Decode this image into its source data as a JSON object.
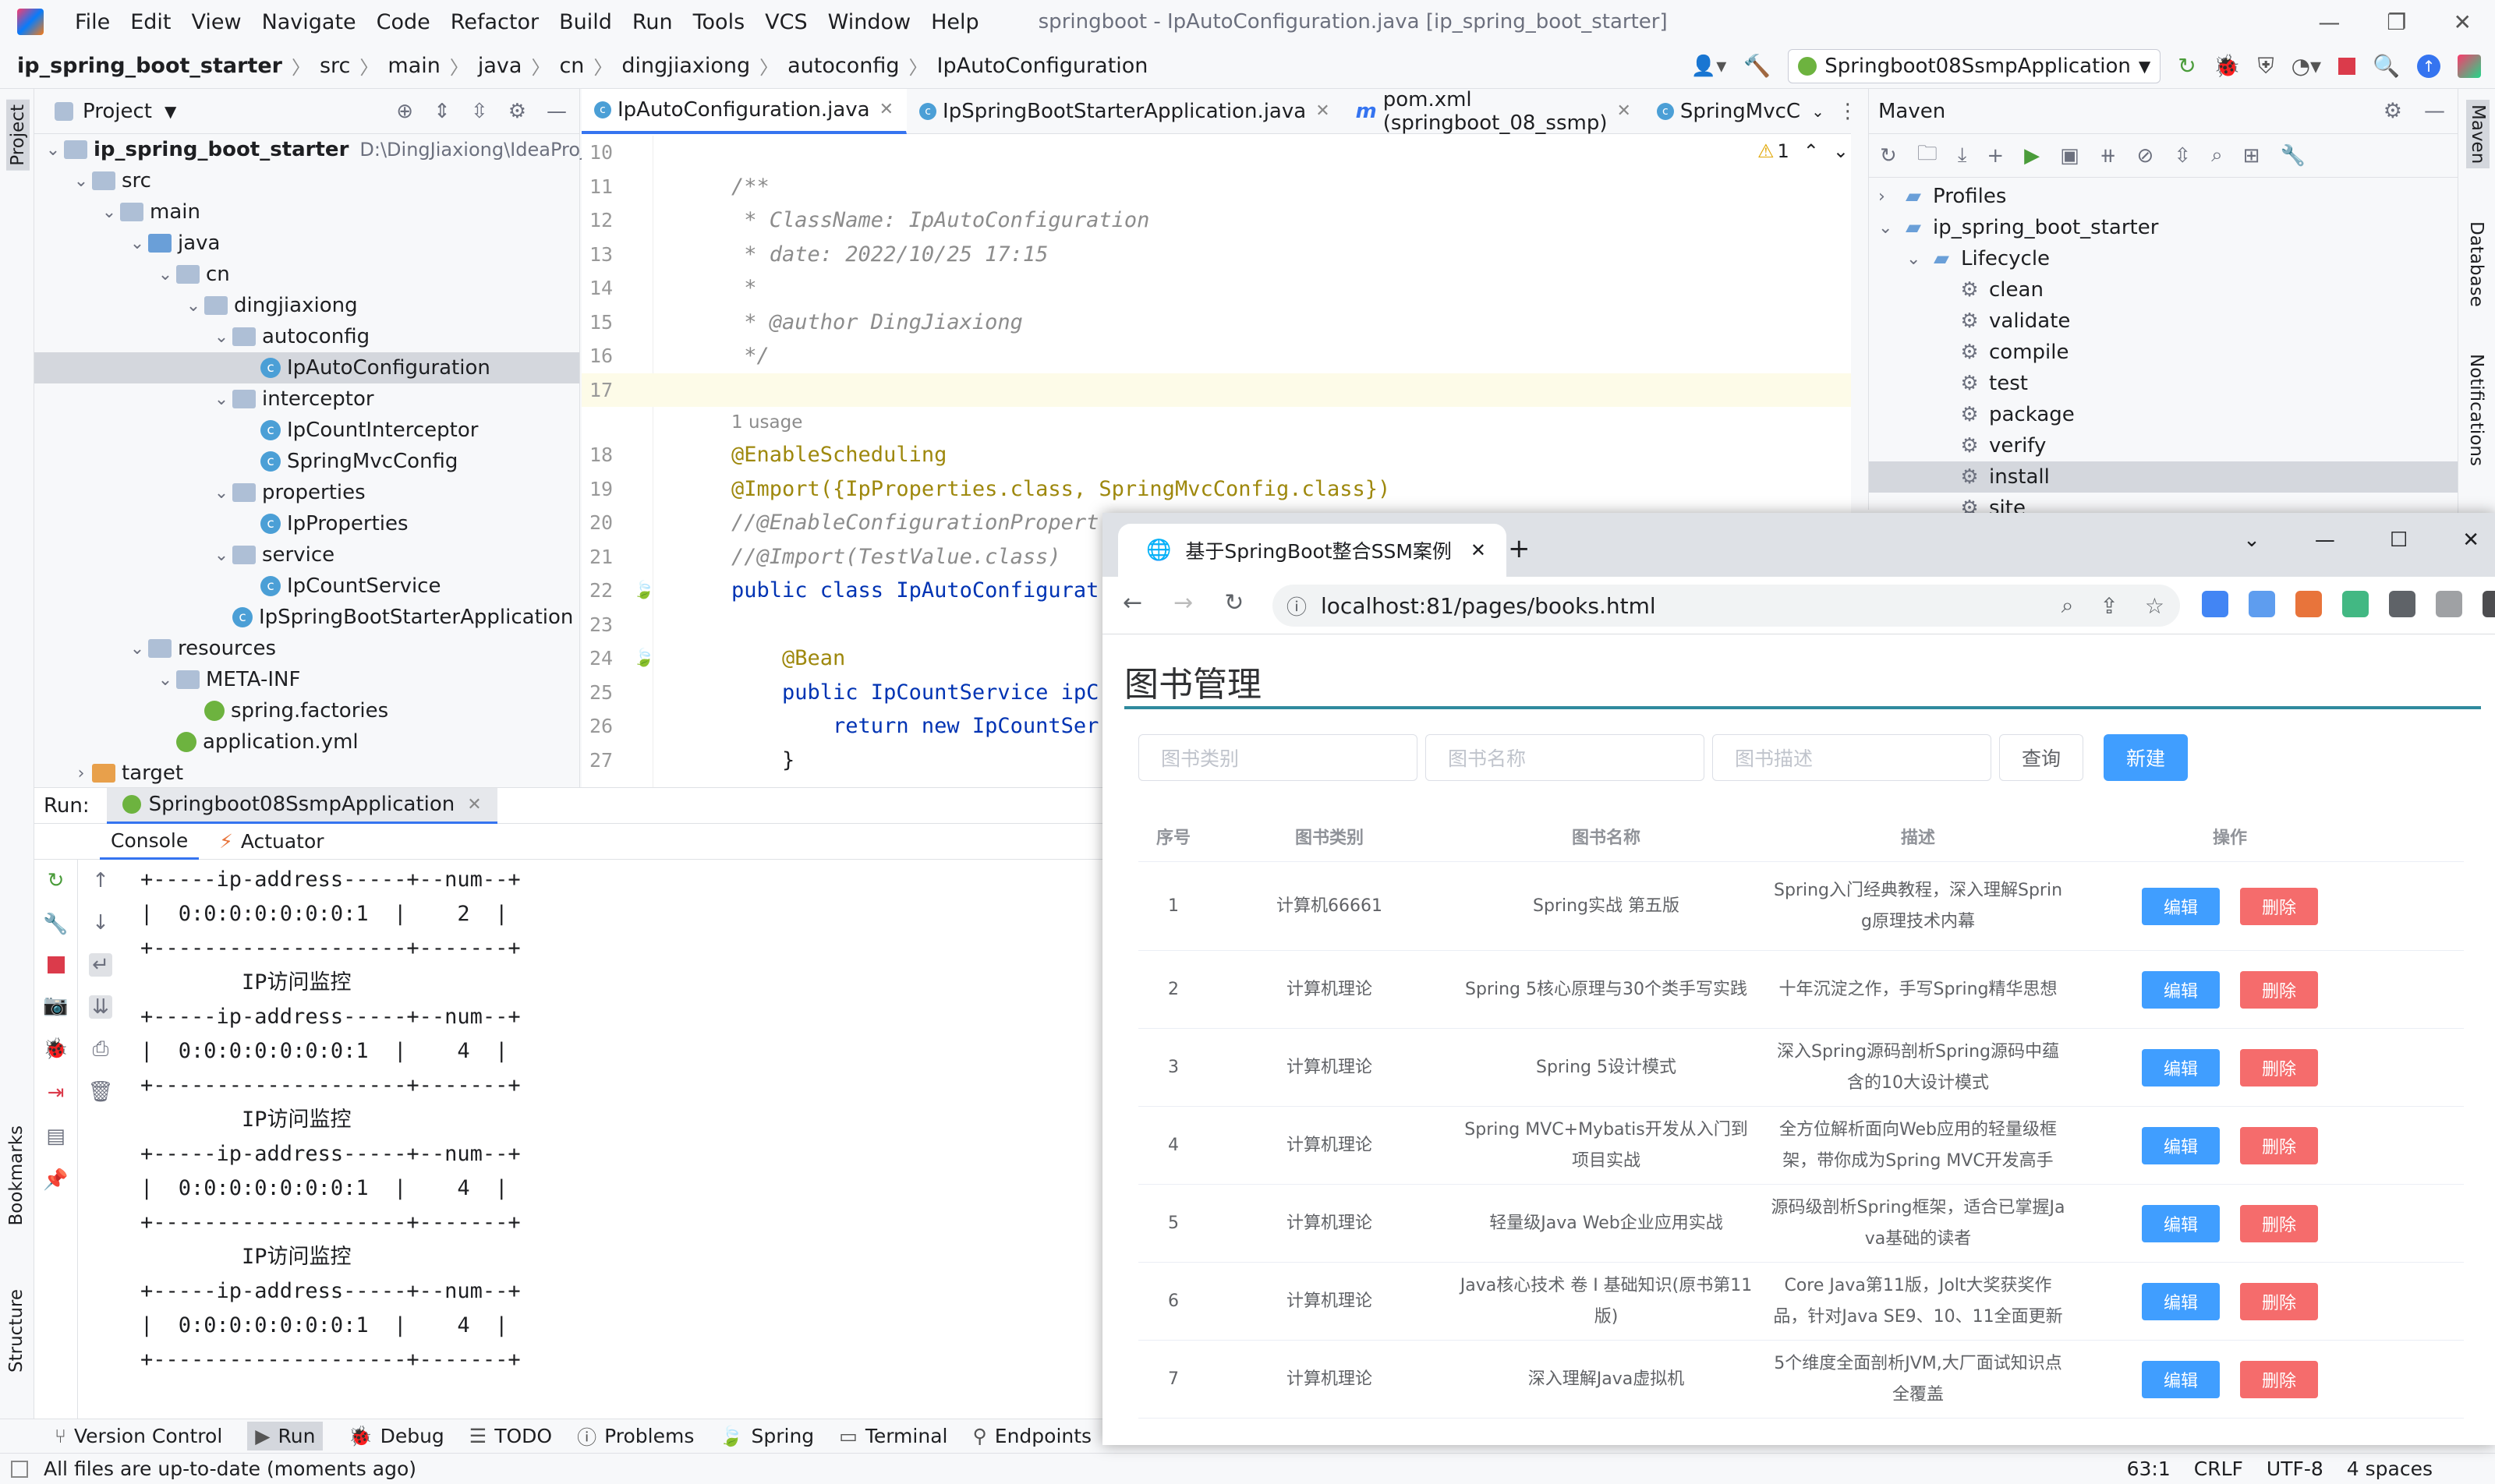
{
  "menu": [
    "File",
    "Edit",
    "View",
    "Navigate",
    "Code",
    "Refactor",
    "Build",
    "Run",
    "Tools",
    "VCS",
    "Window",
    "Help"
  ],
  "window_title": "springboot - IpAutoConfiguration.java [ip_spring_boot_starter]",
  "breadcrumb": [
    "ip_spring_boot_starter",
    "src",
    "main",
    "java",
    "cn",
    "dingjiaxiong",
    "autoconfig",
    "IpAutoConfiguration"
  ],
  "run_config": "Springboot08SsmpApplication",
  "project": {
    "title": "Project",
    "root": "ip_spring_boot_starter",
    "root_path": "D:\\DingJiaxiong\\IdeaProjects",
    "nodes": [
      {
        "label": "src",
        "level": 1,
        "type": "folder"
      },
      {
        "label": "main",
        "level": 2,
        "type": "folder"
      },
      {
        "label": "java",
        "level": 3,
        "type": "folder"
      },
      {
        "label": "cn",
        "level": 4,
        "type": "folder"
      },
      {
        "label": "dingjiaxiong",
        "level": 5,
        "type": "folder"
      },
      {
        "label": "autoconfig",
        "level": 6,
        "type": "folder"
      },
      {
        "label": "IpAutoConfiguration",
        "level": 7,
        "type": "class",
        "selected": true
      },
      {
        "label": "interceptor",
        "level": 6,
        "type": "folder"
      },
      {
        "label": "IpCountInterceptor",
        "level": 7,
        "type": "class"
      },
      {
        "label": "SpringMvcConfig",
        "level": 7,
        "type": "class"
      },
      {
        "label": "properties",
        "level": 6,
        "type": "folder"
      },
      {
        "label": "IpProperties",
        "level": 7,
        "type": "class"
      },
      {
        "label": "service",
        "level": 6,
        "type": "folder"
      },
      {
        "label": "IpCountService",
        "level": 7,
        "type": "class"
      },
      {
        "label": "IpSpringBootStarterApplication",
        "level": 6,
        "type": "class"
      },
      {
        "label": "resources",
        "level": 3,
        "type": "folder"
      },
      {
        "label": "META-INF",
        "level": 4,
        "type": "folder"
      },
      {
        "label": "spring.factories",
        "level": 5,
        "type": "file"
      },
      {
        "label": "application.yml",
        "level": 4,
        "type": "file"
      },
      {
        "label": "target",
        "level": 1,
        "type": "folder-orange"
      }
    ]
  },
  "editor": {
    "tabs": [
      "IpAutoConfiguration.java",
      "IpSpringBootStarterApplication.java",
      "pom.xml (springboot_08_ssmp)",
      "SpringMvcC"
    ],
    "warnings": "1",
    "lines": [
      {
        "n": "10",
        "text": ""
      },
      {
        "n": "11",
        "text": "/**",
        "cls": "cm"
      },
      {
        "n": "12",
        "text": " * ClassName: IpAutoConfiguration",
        "cls": "cm"
      },
      {
        "n": "13",
        "text": " * date: 2022/10/25 17:15",
        "cls": "cm"
      },
      {
        "n": "14",
        "text": " *",
        "cls": "cm"
      },
      {
        "n": "15",
        "text": " * @author DingJiaxiong",
        "cls": "cm"
      },
      {
        "n": "16",
        "text": " */",
        "cls": "cm"
      },
      {
        "n": "17",
        "text": ""
      },
      {
        "n": "",
        "text": "1 usage",
        "cls": "usage"
      },
      {
        "n": "18",
        "text": "@EnableScheduling",
        "cls": "an"
      },
      {
        "n": "19",
        "text": "@Import({IpProperties.class, SpringMvcConfig.class})",
        "cls": "an"
      },
      {
        "n": "20",
        "text": "//@EnableConfigurationPropert",
        "cls": "cm"
      },
      {
        "n": "21",
        "text": "//@Import(TestValue.class)",
        "cls": "cm"
      },
      {
        "n": "22",
        "text": "public class IpAutoConfigurat",
        "cls": "kw"
      },
      {
        "n": "23",
        "text": ""
      },
      {
        "n": "24",
        "text": "    @Bean",
        "cls": "an"
      },
      {
        "n": "25",
        "text": "    public IpCountService ipC",
        "cls": "kw"
      },
      {
        "n": "26",
        "text": "        return new IpCountSer",
        "cls": "kw"
      },
      {
        "n": "27",
        "text": "    }"
      }
    ]
  },
  "maven": {
    "title": "Maven",
    "items": [
      {
        "label": "Profiles",
        "level": 0
      },
      {
        "label": "ip_spring_boot_starter",
        "level": 0
      },
      {
        "label": "Lifecycle",
        "level": 1
      },
      {
        "label": "clean",
        "level": 2
      },
      {
        "label": "validate",
        "level": 2
      },
      {
        "label": "compile",
        "level": 2
      },
      {
        "label": "test",
        "level": 2
      },
      {
        "label": "package",
        "level": 2
      },
      {
        "label": "verify",
        "level": 2
      },
      {
        "label": "install",
        "level": 2,
        "selected": true
      },
      {
        "label": "site",
        "level": 2
      }
    ]
  },
  "right_strip": [
    "Maven",
    "Database",
    "Notifications"
  ],
  "left_strip": [
    "Project",
    "Bookmarks",
    "Structure"
  ],
  "run": {
    "label": "Run:",
    "config": "Springboot08SsmpApplication",
    "tabs": [
      "Console",
      "Actuator"
    ],
    "console": "+-----ip-address-----+--num--+\n|  0:0:0:0:0:0:0:1  |    2  |\n+--------------------+-------+\n        IP访问监控\n+-----ip-address-----+--num--+\n|  0:0:0:0:0:0:0:1  |    4  |\n+--------------------+-------+\n        IP访问监控\n+-----ip-address-----+--num--+\n|  0:0:0:0:0:0:0:1  |    4  |\n+--------------------+-------+\n        IP访问监控\n+-----ip-address-----+--num--+\n|  0:0:0:0:0:0:0:1  |    4  |\n+--------------------+-------+"
  },
  "toolwindows": [
    "Version Control",
    "Run",
    "Debug",
    "TODO",
    "Problems",
    "Spring",
    "Terminal",
    "Endpoints"
  ],
  "status": {
    "message": "All files are up-to-date (moments ago)",
    "position": "63:1",
    "line_sep": "CRLF",
    "encoding": "UTF-8",
    "indent": "4 spaces"
  },
  "browser": {
    "tab_title": "基于SpringBoot整合SSM案例",
    "url": "localhost:81/pages/books.html",
    "page_title": "图书管理",
    "filters": [
      "图书类别",
      "图书名称",
      "图书描述"
    ],
    "query_btn": "查询",
    "new_btn": "新建",
    "columns": [
      "序号",
      "图书类别",
      "图书名称",
      "描述",
      "操作"
    ],
    "edit_label": "编辑",
    "delete_label": "删除",
    "rows": [
      {
        "no": "1",
        "type": "计算机66661",
        "name": "Spring实战 第五版",
        "desc": "Spring入门经典教程，深入理解Sprin\ng原理技术内幕"
      },
      {
        "no": "2",
        "type": "计算机理论",
        "name": "Spring 5核心原理与30个类手写实践",
        "desc": "十年沉淀之作，手写Spring精华思想"
      },
      {
        "no": "3",
        "type": "计算机理论",
        "name": "Spring 5设计模式",
        "desc": "深入Spring源码剖析Spring源码中蕴\n含的10大设计模式"
      },
      {
        "no": "4",
        "type": "计算机理论",
        "name": "Spring MVC+Mybatis开发从入门到\n项目实战",
        "desc": "全方位解析面向Web应用的轻量级框\n架，带你成为Spring MVC开发高手"
      },
      {
        "no": "5",
        "type": "计算机理论",
        "name": "轻量级Java Web企业应用实战",
        "desc": "源码级剖析Spring框架，适合已掌握Ja\nva基础的读者"
      },
      {
        "no": "6",
        "type": "计算机理论",
        "name": "Java核心技术 卷 I 基础知识(原书第11\n版)",
        "desc": "Core Java第11版，Jolt大奖获奖作\n品，针对Java SE9、10、11全面更新"
      },
      {
        "no": "7",
        "type": "计算机理论",
        "name": "深入理解Java虚拟机",
        "desc": "5个维度全面剖析JVM,大厂面试知识点\n全覆盖"
      }
    ]
  },
  "colors": {
    "accent": "#3574f0",
    "primary": "#409eff",
    "danger": "#f56c6c",
    "teal": "#2f8a9e"
  }
}
